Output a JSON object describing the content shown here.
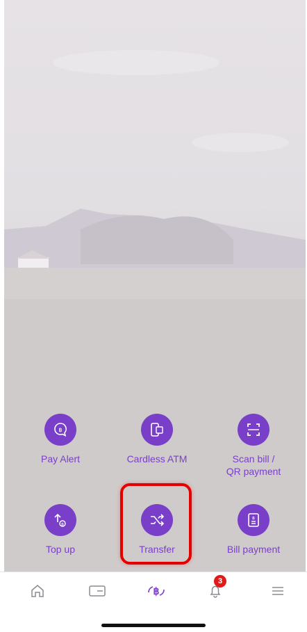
{
  "actions": [
    {
      "id": "pay-alert",
      "label": "Pay Alert",
      "icon": "pay-alert-icon"
    },
    {
      "id": "cardless-atm",
      "label": "Cardless ATM",
      "icon": "cardless-atm-icon"
    },
    {
      "id": "scan-bill",
      "label": "Scan bill /\nQR payment",
      "icon": "scan-icon"
    },
    {
      "id": "top-up",
      "label": "Top up",
      "icon": "top-up-icon"
    },
    {
      "id": "transfer",
      "label": "Transfer",
      "icon": "transfer-icon"
    },
    {
      "id": "bill-payment",
      "label": "Bill payment",
      "icon": "bill-icon"
    }
  ],
  "tabbar": {
    "items": [
      {
        "name": "home",
        "icon": "home-icon"
      },
      {
        "name": "cards",
        "icon": "card-icon"
      },
      {
        "name": "baht",
        "icon": "baht-exchange-icon"
      },
      {
        "name": "notifications",
        "icon": "bell-icon",
        "badge": "3"
      },
      {
        "name": "menu",
        "icon": "menu-icon"
      }
    ]
  },
  "colors": {
    "accent": "#7a3fc8",
    "highlight": "#e20000",
    "badge": "#e11a1a"
  }
}
